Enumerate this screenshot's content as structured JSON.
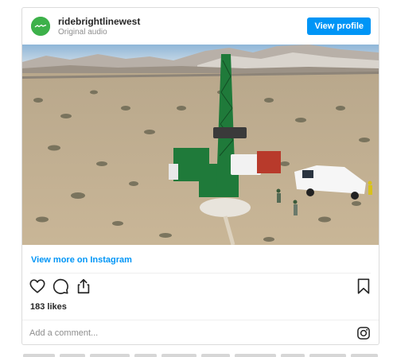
{
  "post": {
    "username": "ridebrightlinewest",
    "subtitle": "Original audio",
    "view_profile_label": "View profile",
    "view_more_label": "View more on Instagram",
    "likes": "183 likes",
    "comment_placeholder": "Add a comment..."
  },
  "icons": {
    "like": "heart-icon",
    "comment": "comment-icon",
    "share": "share-icon",
    "save": "bookmark-icon",
    "instagram": "instagram-icon"
  },
  "colors": {
    "accent": "#0095f6",
    "avatar": "#3db14a",
    "border": "#dbdbdb",
    "muted": "#8e8e8e",
    "drill_rig": "#1f7a3a"
  }
}
